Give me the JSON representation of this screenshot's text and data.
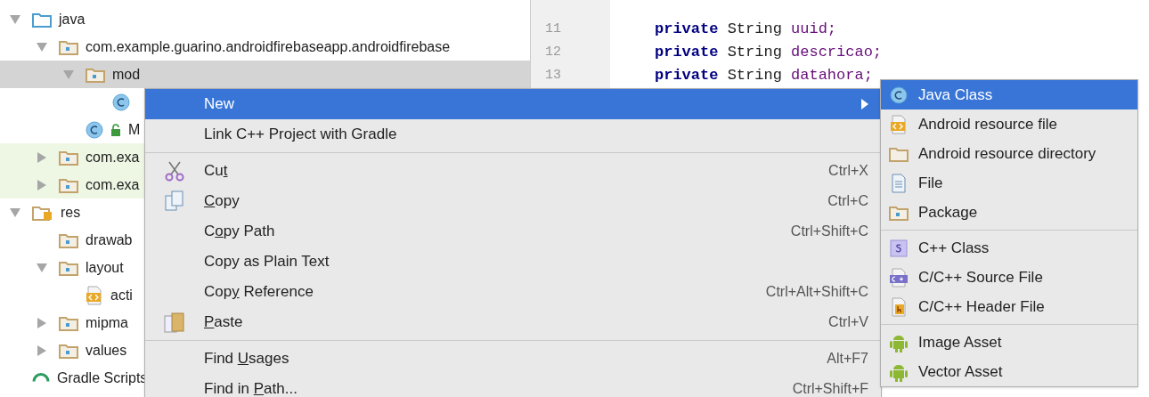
{
  "project_tree": [
    {
      "label": "java",
      "kind": "source-folder",
      "expanded": true,
      "selected": false,
      "highlighted": false,
      "children": [
        {
          "label": "com.example.guarino.androidfirebaseapp.androidfirebase",
          "kind": "package",
          "expanded": true,
          "selected": false,
          "highlighted": false,
          "children": [
            {
              "label": "mod",
              "kind": "package",
              "expanded": true,
              "selected": true,
              "highlighted": false,
              "children": [
                {
                  "kind": "class",
                  "selected": false,
                  "highlighted": false
                }
              ]
            },
            {
              "label": "M",
              "kind": "class-locked",
              "selected": false,
              "highlighted": false
            }
          ]
        },
        {
          "label": "com.exa",
          "kind": "package",
          "expanded": false,
          "selected": false,
          "highlighted": true
        },
        {
          "label": "com.exa",
          "kind": "package",
          "expanded": false,
          "selected": false,
          "highlighted": true
        }
      ]
    },
    {
      "label": "res",
      "kind": "res-folder",
      "expanded": true,
      "selected": false,
      "highlighted": false,
      "children": [
        {
          "label": "drawab",
          "kind": "package",
          "selected": false,
          "highlighted": false
        },
        {
          "label": "layout",
          "kind": "package",
          "expanded": true,
          "selected": false,
          "highlighted": false,
          "children": [
            {
              "label": "acti",
              "kind": "layout-file",
              "selected": false,
              "highlighted": false
            }
          ]
        },
        {
          "label": "mipma",
          "kind": "package",
          "expanded": false,
          "selected": false,
          "highlighted": false
        },
        {
          "label": "values",
          "kind": "package",
          "expanded": false,
          "selected": false,
          "highlighted": false
        }
      ]
    },
    {
      "label": "Gradle Scripts",
      "kind": "gradle",
      "selected": false,
      "highlighted": false
    }
  ],
  "editor": {
    "lines": [
      {
        "number": "11",
        "keyword": "private",
        "type": "String",
        "field": "uuid;"
      },
      {
        "number": "12",
        "keyword": "private",
        "type": "String",
        "field": "descricao;"
      },
      {
        "number": "13",
        "keyword": "private",
        "type": "String",
        "field": "datahora;"
      }
    ]
  },
  "context_menu": [
    {
      "kind": "plain",
      "label": "New",
      "selected": true,
      "submenu": true
    },
    {
      "kind": "plain",
      "label": "Link C++ Project with Gradle",
      "selected": false
    },
    {
      "kind": "separator"
    },
    {
      "kind": "scissors",
      "before": "Cu",
      "mnemonic": "t",
      "shortcut": "Ctrl+X",
      "selected": false
    },
    {
      "kind": "copy",
      "mnemonic": "C",
      "after": "opy",
      "shortcut": "Ctrl+C",
      "selected": false
    },
    {
      "kind": "plain",
      "before": "C",
      "mnemonic": "o",
      "after": "py Path",
      "shortcut": "Ctrl+Shift+C",
      "selected": false
    },
    {
      "kind": "plain",
      "label": "Copy as Plain Text",
      "selected": false
    },
    {
      "kind": "plain",
      "before": "Cop",
      "mnemonic": "y",
      "after": " Reference",
      "shortcut": "Ctrl+Alt+Shift+C",
      "selected": false
    },
    {
      "kind": "paste",
      "mnemonic": "P",
      "after": "aste",
      "shortcut": "Ctrl+V",
      "selected": false
    },
    {
      "kind": "separator"
    },
    {
      "kind": "plain",
      "before": "Find ",
      "mnemonic": "U",
      "after": "sages",
      "shortcut": "Alt+F7",
      "selected": false
    },
    {
      "kind": "plain",
      "before": "Find in ",
      "mnemonic": "P",
      "after": "ath...",
      "shortcut": "Ctrl+Shift+F",
      "selected": false
    }
  ],
  "new_submenu": [
    {
      "kind": "class",
      "label": "Java Class",
      "selected": true
    },
    {
      "kind": "resource-file",
      "label": "Android resource file",
      "selected": false
    },
    {
      "kind": "folder",
      "label": "Android resource directory",
      "selected": false
    },
    {
      "kind": "file",
      "label": "File",
      "selected": false
    },
    {
      "kind": "package",
      "label": "Package",
      "selected": false
    },
    {
      "kind": "separator"
    },
    {
      "kind": "cpp-class",
      "label": "C++ Class",
      "selected": false
    },
    {
      "kind": "cpp-source",
      "label": "C/C++ Source File",
      "selected": false
    },
    {
      "kind": "cpp-header",
      "label": "C/C++ Header File",
      "selected": false
    },
    {
      "kind": "separator"
    },
    {
      "kind": "android",
      "label": "Image Asset",
      "selected": false
    },
    {
      "kind": "android",
      "label": "Vector Asset",
      "selected": false
    }
  ]
}
